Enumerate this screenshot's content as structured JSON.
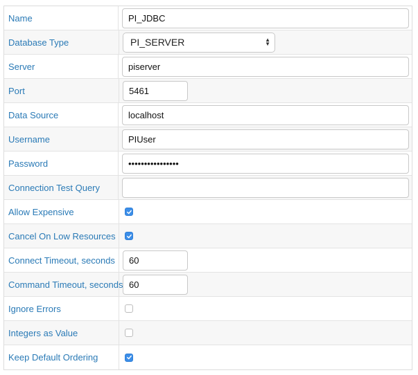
{
  "form": {
    "rows": [
      {
        "label": "Name",
        "type": "text",
        "value": "PI_JDBC",
        "width": "wide"
      },
      {
        "label": "Database Type",
        "type": "select",
        "value": "PI_SERVER"
      },
      {
        "label": "Server",
        "type": "text",
        "value": "piserver",
        "width": "wide"
      },
      {
        "label": "Port",
        "type": "text",
        "value": "5461",
        "width": "narrow"
      },
      {
        "label": "Data Source",
        "type": "text",
        "value": "localhost",
        "width": "wide"
      },
      {
        "label": "Username",
        "type": "text",
        "value": "PIUser",
        "width": "wide"
      },
      {
        "label": "Password",
        "type": "password",
        "value": "••••••••••••••••",
        "width": "wide"
      },
      {
        "label": "Connection Test Query",
        "type": "text",
        "value": "",
        "width": "wide"
      },
      {
        "label": "Allow Expensive",
        "type": "checkbox",
        "checked": true
      },
      {
        "label": "Cancel On Low Resources",
        "type": "checkbox",
        "checked": true
      },
      {
        "label": "Connect Timeout, seconds",
        "type": "text",
        "value": "60",
        "width": "narrow"
      },
      {
        "label": "Command Timeout, seconds",
        "type": "text",
        "value": "60",
        "width": "narrow"
      },
      {
        "label": "Ignore Errors",
        "type": "checkbox",
        "checked": false
      },
      {
        "label": "Integers as Value",
        "type": "checkbox",
        "checked": false
      },
      {
        "label": "Keep Default Ordering",
        "type": "checkbox",
        "checked": true
      }
    ]
  },
  "colors": {
    "label": "#2a7ab6",
    "checkbox_checked": "#3c8ee8",
    "row_alt": "#f7f7f7"
  },
  "icons": {
    "select_arrows": "up-down-chevron-icon",
    "checkmark": "checkmark-icon"
  }
}
